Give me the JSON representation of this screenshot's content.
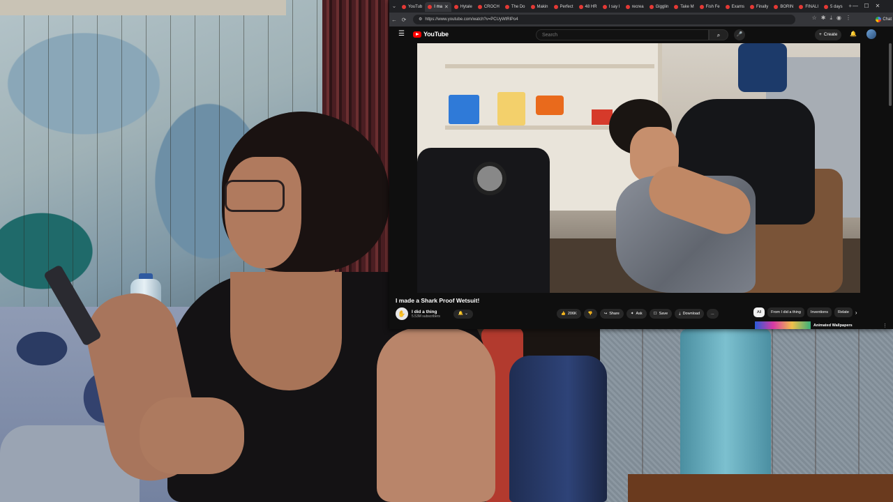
{
  "browser": {
    "tabs": [
      {
        "label": "YouTub",
        "active": false
      },
      {
        "label": "I ma",
        "active": true
      },
      {
        "label": "Hytale",
        "active": false
      },
      {
        "label": "CROCH",
        "active": false
      },
      {
        "label": "The Do",
        "active": false
      },
      {
        "label": "Makin",
        "active": false
      },
      {
        "label": "Perfect",
        "active": false
      },
      {
        "label": "48 HR",
        "active": false
      },
      {
        "label": "I say I",
        "active": false
      },
      {
        "label": "recrea",
        "active": false
      },
      {
        "label": "Gigglin",
        "active": false
      },
      {
        "label": "Take M",
        "active": false
      },
      {
        "label": "Fish Fe",
        "active": false
      },
      {
        "label": "Exams",
        "active": false
      },
      {
        "label": "Finally",
        "active": false
      },
      {
        "label": "BORIN",
        "active": false
      },
      {
        "label": "FINALI",
        "active": false
      },
      {
        "label": "5 days",
        "active": false
      }
    ],
    "new_tab": "+",
    "chat_label": "Chat",
    "url": "https://www.youtube.com/watch?v=PCUyWtRlPo4"
  },
  "youtube": {
    "logo_text": "YouTube",
    "search_placeholder": "Search",
    "create_label": "Create",
    "video_title": "I made a Shark Proof Wetsuit!",
    "channel_name": "I did a thing",
    "channel_subs": "5.53M subscribers",
    "actions": {
      "likes": "206K",
      "share": "Share",
      "ask": "Ask",
      "save": "Save",
      "download": "Download",
      "more": "..."
    },
    "chips": [
      "All",
      "From I did a thing",
      "Inventions",
      "Relate"
    ],
    "selected_chip": "All",
    "promo_label": "Animated Wallpapers"
  },
  "icons": {
    "back": "←",
    "forward": "→",
    "reload": "⟳",
    "search": "⌕",
    "mic": "🎙",
    "bell": "🔔",
    "menu": "☰",
    "like": "👍",
    "dislike": "👎",
    "share": "↪",
    "ask": "✦",
    "save": "☐",
    "download": "⤓",
    "next": "›"
  },
  "colors": {
    "youtube_red": "#ff0000",
    "yt_background": "#0f0f0f",
    "chip_selected": "#f1f1f1"
  }
}
